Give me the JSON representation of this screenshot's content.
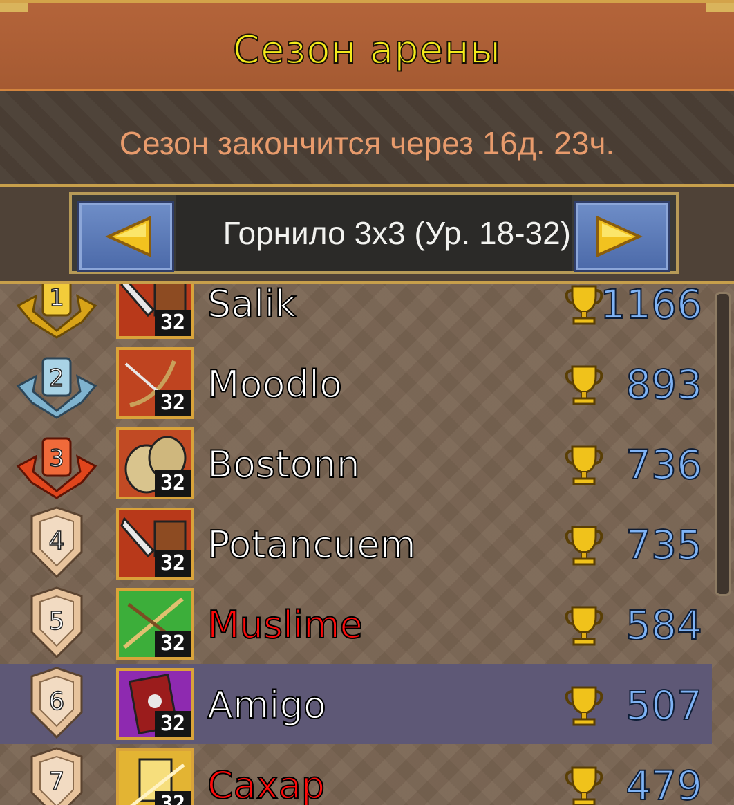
{
  "header": {
    "title": "Сезон арены"
  },
  "season": {
    "ends_text": "Сезон закончится через 16д. 23ч."
  },
  "selector": {
    "label": "Горнило 3х3 (Ур. 18-32)"
  },
  "rows": [
    {
      "rank": "1",
      "name": "Salik",
      "level": "32",
      "score": "1166",
      "name_color": "white"
    },
    {
      "rank": "2",
      "name": "Moodlo",
      "level": "32",
      "score": "893",
      "name_color": "white"
    },
    {
      "rank": "3",
      "name": "Bostonn",
      "level": "32",
      "score": "736",
      "name_color": "white"
    },
    {
      "rank": "4",
      "name": "Potancuem",
      "level": "32",
      "score": "735",
      "name_color": "white"
    },
    {
      "rank": "5",
      "name": "Muslime",
      "level": "32",
      "score": "584",
      "name_color": "red"
    },
    {
      "rank": "6",
      "name": "Amigo",
      "level": "32",
      "score": "507",
      "name_color": "white",
      "highlighted": true
    },
    {
      "rank": "7",
      "name": "Сахар",
      "level": "32",
      "score": "479",
      "name_color": "red"
    }
  ]
}
